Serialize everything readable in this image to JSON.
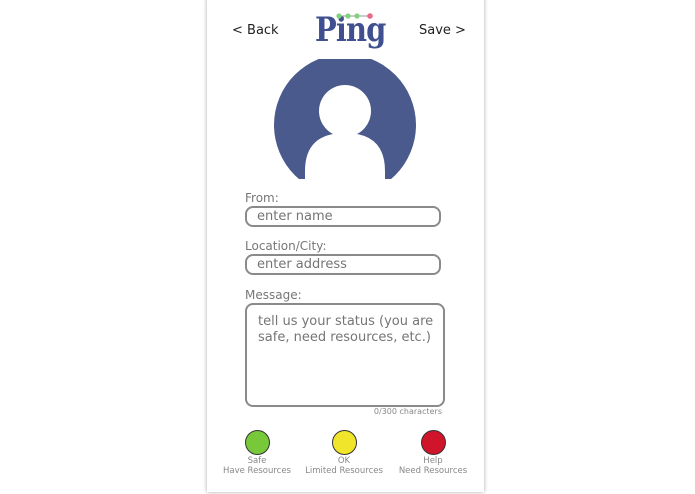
{
  "header": {
    "back_label": "< Back",
    "save_label": "Save >",
    "logo_text": "Ping"
  },
  "colors": {
    "logo": "#3f4f8f",
    "avatar_bg": "#4a5a8c",
    "logo_dots": [
      "#7fd27f",
      "#7fd27f",
      "#7fd27f",
      "#e86a8a"
    ]
  },
  "form": {
    "from_label": "From:",
    "from_placeholder": "enter name",
    "location_label": "Location/City:",
    "location_placeholder": "enter address",
    "message_label": "Message:",
    "message_placeholder": "tell us your status (you are safe, need resources, etc.)",
    "counter": "0/300 characters"
  },
  "statuses": [
    {
      "line1": "Safe",
      "line2": "Have Resources",
      "color": "#77c93a"
    },
    {
      "line1": "OK",
      "line2": "Limited Resources",
      "color": "#f0e52a"
    },
    {
      "line1": "Help",
      "line2": "Need Resources",
      "color": "#d0152a"
    }
  ]
}
